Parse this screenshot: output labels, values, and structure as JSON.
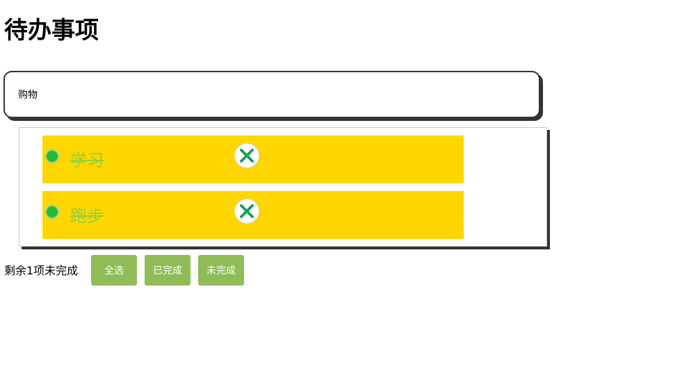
{
  "header": {
    "title": "待办事项"
  },
  "input": {
    "value": "购物"
  },
  "todos": [
    {
      "label": "学习",
      "completed": true
    },
    {
      "label": "跑步",
      "completed": true
    }
  ],
  "footer": {
    "status": "剩余1项未完成",
    "select_all_label": "全选",
    "completed_label": "已完成",
    "incomplete_label": "未完成"
  },
  "colors": {
    "item_background": "#ffd700",
    "item_text": "#9acd32",
    "check": "#22bb33",
    "delete_icon": "#1a9e5c",
    "button": "#8fbc57"
  }
}
